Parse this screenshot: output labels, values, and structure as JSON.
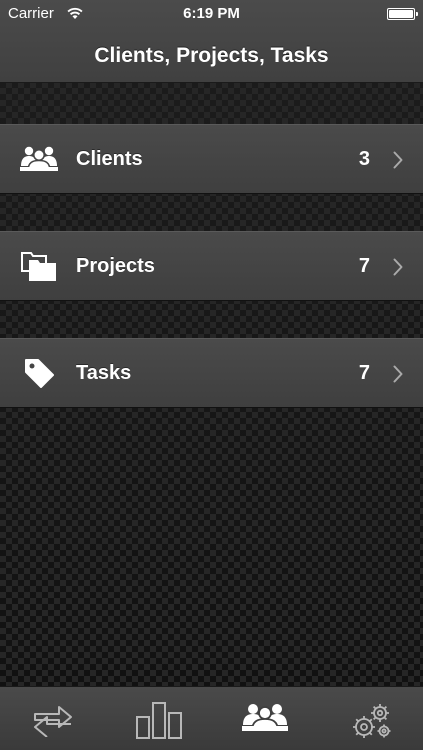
{
  "status_bar": {
    "carrier": "Carrier",
    "time": "6:19 PM",
    "battery_level": 1.0
  },
  "nav": {
    "title": "Clients, Projects, Tasks"
  },
  "rows": [
    {
      "label": "Clients",
      "count": "3",
      "icon": "clients-icon"
    },
    {
      "label": "Projects",
      "count": "7",
      "icon": "folder-icon"
    },
    {
      "label": "Tasks",
      "count": "7",
      "icon": "tag-icon"
    }
  ],
  "tabs": [
    {
      "icon": "sync-arrows-icon",
      "selected": false
    },
    {
      "icon": "bar-chart-icon",
      "selected": false
    },
    {
      "icon": "clients-icon",
      "selected": true
    },
    {
      "icon": "gears-icon",
      "selected": false
    }
  ],
  "colors": {
    "selected_tab": "#ffffff",
    "unselected_tab": "#b8b8b8",
    "row_background": "#454545",
    "bar_background": "#454545"
  }
}
